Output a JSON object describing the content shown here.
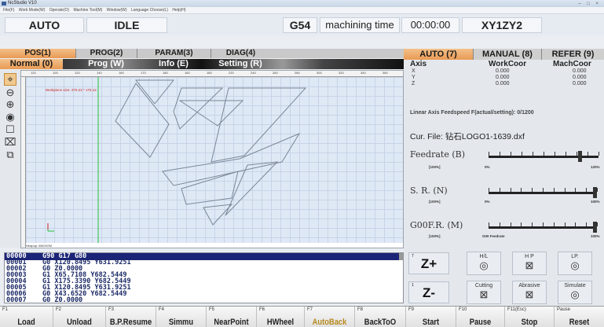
{
  "window": {
    "title": "NcStudio V10",
    "controls": "–  □  ×"
  },
  "menu": [
    "File(F)",
    "Work Mode(W)",
    "Operate(O)",
    "Machine Tool(M)",
    "Window(W)",
    "Language Choose(L)",
    "Help(H)"
  ],
  "status": {
    "mode": "AUTO",
    "state": "IDLE",
    "coord_system": "G54",
    "machining_time_label": "machining time",
    "machining_time": "00:00:00",
    "axis_mode": "XY1ZY2"
  },
  "tabs_row1": [
    "POS(1)",
    "PROG(2)",
    "PARAM(3)",
    "DIAG(4)"
  ],
  "tabs_row2": [
    "Normal (0)",
    "Prog (W)",
    "Info (E)",
    "Setting (R)"
  ],
  "canvas": {
    "workpiece_size": "Workpiece size:  270.22 * 175.12",
    "heap_info": "Heapup: 6M/192M",
    "ruler_labels": [
      "120",
      "100",
      "120",
      "140",
      "160",
      "170",
      "180",
      "160",
      "180",
      "220",
      "240",
      "260",
      "280",
      "300",
      "320",
      "340",
      "360"
    ]
  },
  "code_lines": [
    {
      "num": "00000",
      "text": "G90 G17 G80"
    },
    {
      "num": "00001",
      "text": "G0 X120.8495 Y631.9251"
    },
    {
      "num": "00002",
      "text": "G0 Z0.0000"
    },
    {
      "num": "00003",
      "text": "G1 X65.7108 Y682.5449"
    },
    {
      "num": "00004",
      "text": "G1 X175.3390 Y682.5449"
    },
    {
      "num": "00005",
      "text": "G1 X120.8495 Y631.9251"
    },
    {
      "num": "00006",
      "text": "G0 X43.6520 Y682.5449"
    },
    {
      "num": "00007",
      "text": "G0 Z0.0000"
    }
  ],
  "right_tabs": [
    "AUTO (7)",
    "MANUAL (8)",
    "REFER (9)"
  ],
  "coords": {
    "headers": {
      "axis": "Axis",
      "work": "WorkCoor",
      "mach": "MachCoor"
    },
    "rows": [
      {
        "axis": "X",
        "work": "0.000",
        "mach": "0.000"
      },
      {
        "axis": "Y",
        "work": "0.000",
        "mach": "0.000"
      },
      {
        "axis": "Z",
        "work": "0.000",
        "mach": "0.000"
      }
    ]
  },
  "feed_info": "Linear Axis Feedspeed F(actual/setting): 0/1200",
  "cur_file": "Cur. File: 钻石LOGO1-1639.dxf",
  "overrides": [
    {
      "label": "Feedrate (B)",
      "current": "[100%]",
      "min": "0%",
      "max": "120%",
      "value_fraction": 0.833
    },
    {
      "label": "S. R. (N)",
      "current": "[100%]",
      "min": "0%",
      "max": "100%",
      "value_fraction": 1.0
    },
    {
      "label": "G00F.R. (M)",
      "current": "[100%]",
      "min": "G00 Feedrate",
      "max": "100%",
      "value_fraction": 1.0
    }
  ],
  "jog": {
    "zplus": "Z+",
    "zminus": "Z-",
    "zplus_corner": "7",
    "zminus_corner": "1"
  },
  "tool_buttons": {
    "hl": "H/L",
    "hp": "H P",
    "lp": "LP.",
    "cutting": "Cutting",
    "abrasive": "Abrasive",
    "simulate": "Simulate"
  },
  "fkeys": [
    {
      "fn": "F1",
      "label": "Load"
    },
    {
      "fn": "F2",
      "label": "Unload"
    },
    {
      "fn": "F3",
      "label": "B.P.Resume"
    },
    {
      "fn": "F4",
      "label": "Simmu"
    },
    {
      "fn": "F5",
      "label": "NearPoint"
    },
    {
      "fn": "F6",
      "label": "HWheel"
    },
    {
      "fn": "F7",
      "label": "AutoBack"
    },
    {
      "fn": "F8",
      "label": "BackToO"
    },
    {
      "fn": "F9",
      "label": "Start"
    },
    {
      "fn": "F10",
      "label": "Pause"
    },
    {
      "fn": "F11(Esc)",
      "label": "Stop"
    },
    {
      "fn": "Pause",
      "label": "Reset"
    }
  ],
  "colors": {
    "accent_tab": "#e99a54",
    "code_selected": "#1b2477",
    "workpiece_label": "#cc2222",
    "drawing_stroke": "#7b8797"
  }
}
